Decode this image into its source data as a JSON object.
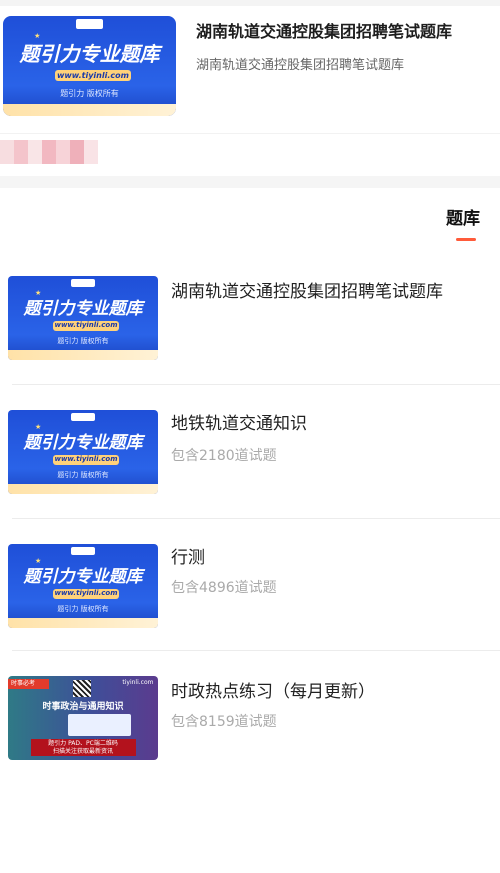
{
  "featured": {
    "title": "湖南轨道交通控股集团招聘笔试题库",
    "subtitle": "湖南轨道交通控股集团招聘笔试题库",
    "thumbnail": {
      "headline": "题引力专业题库",
      "url": "www.tiyinli.com",
      "footer": "题引力 版权所有"
    }
  },
  "blurred_colors": [
    "#f7dde0",
    "#f4c4cb",
    "#f9e5e7",
    "#f2b8c1",
    "#f7d3d8",
    "#efb0ba",
    "#f9e3e6"
  ],
  "section": {
    "tab_label": "题库",
    "accent_color": "#ff5b3a"
  },
  "items": [
    {
      "name": "湖南轨道交通控股集团招聘笔试题库",
      "count": "",
      "thumb_type": "brand",
      "thumbnail": {
        "headline": "题引力专业题库",
        "url": "www.tiyinli.com",
        "footer": "题引力 版权所有"
      }
    },
    {
      "name": "地铁轨道交通知识",
      "count": "包含2180道试题",
      "thumb_type": "brand",
      "thumbnail": {
        "headline": "题引力专业题库",
        "url": "www.tiyinli.com",
        "footer": "题引力 版权所有"
      }
    },
    {
      "name": "行测",
      "count": "包含4896道试题",
      "thumb_type": "brand",
      "thumbnail": {
        "headline": "题引力专业题库",
        "url": "www.tiyinli.com",
        "footer": "题引力 版权所有"
      }
    },
    {
      "name": "时政热点练习（每月更新）",
      "count": "包含8159道试题",
      "thumb_type": "news",
      "thumbnail": {
        "tag": "时事必考",
        "site": "tiyinli.com",
        "headline": "时事政治与通用知识",
        "footer_line1": "题引力 PAD、PC端二维码",
        "footer_line2": "扫描关注获取最新资讯"
      }
    }
  ]
}
